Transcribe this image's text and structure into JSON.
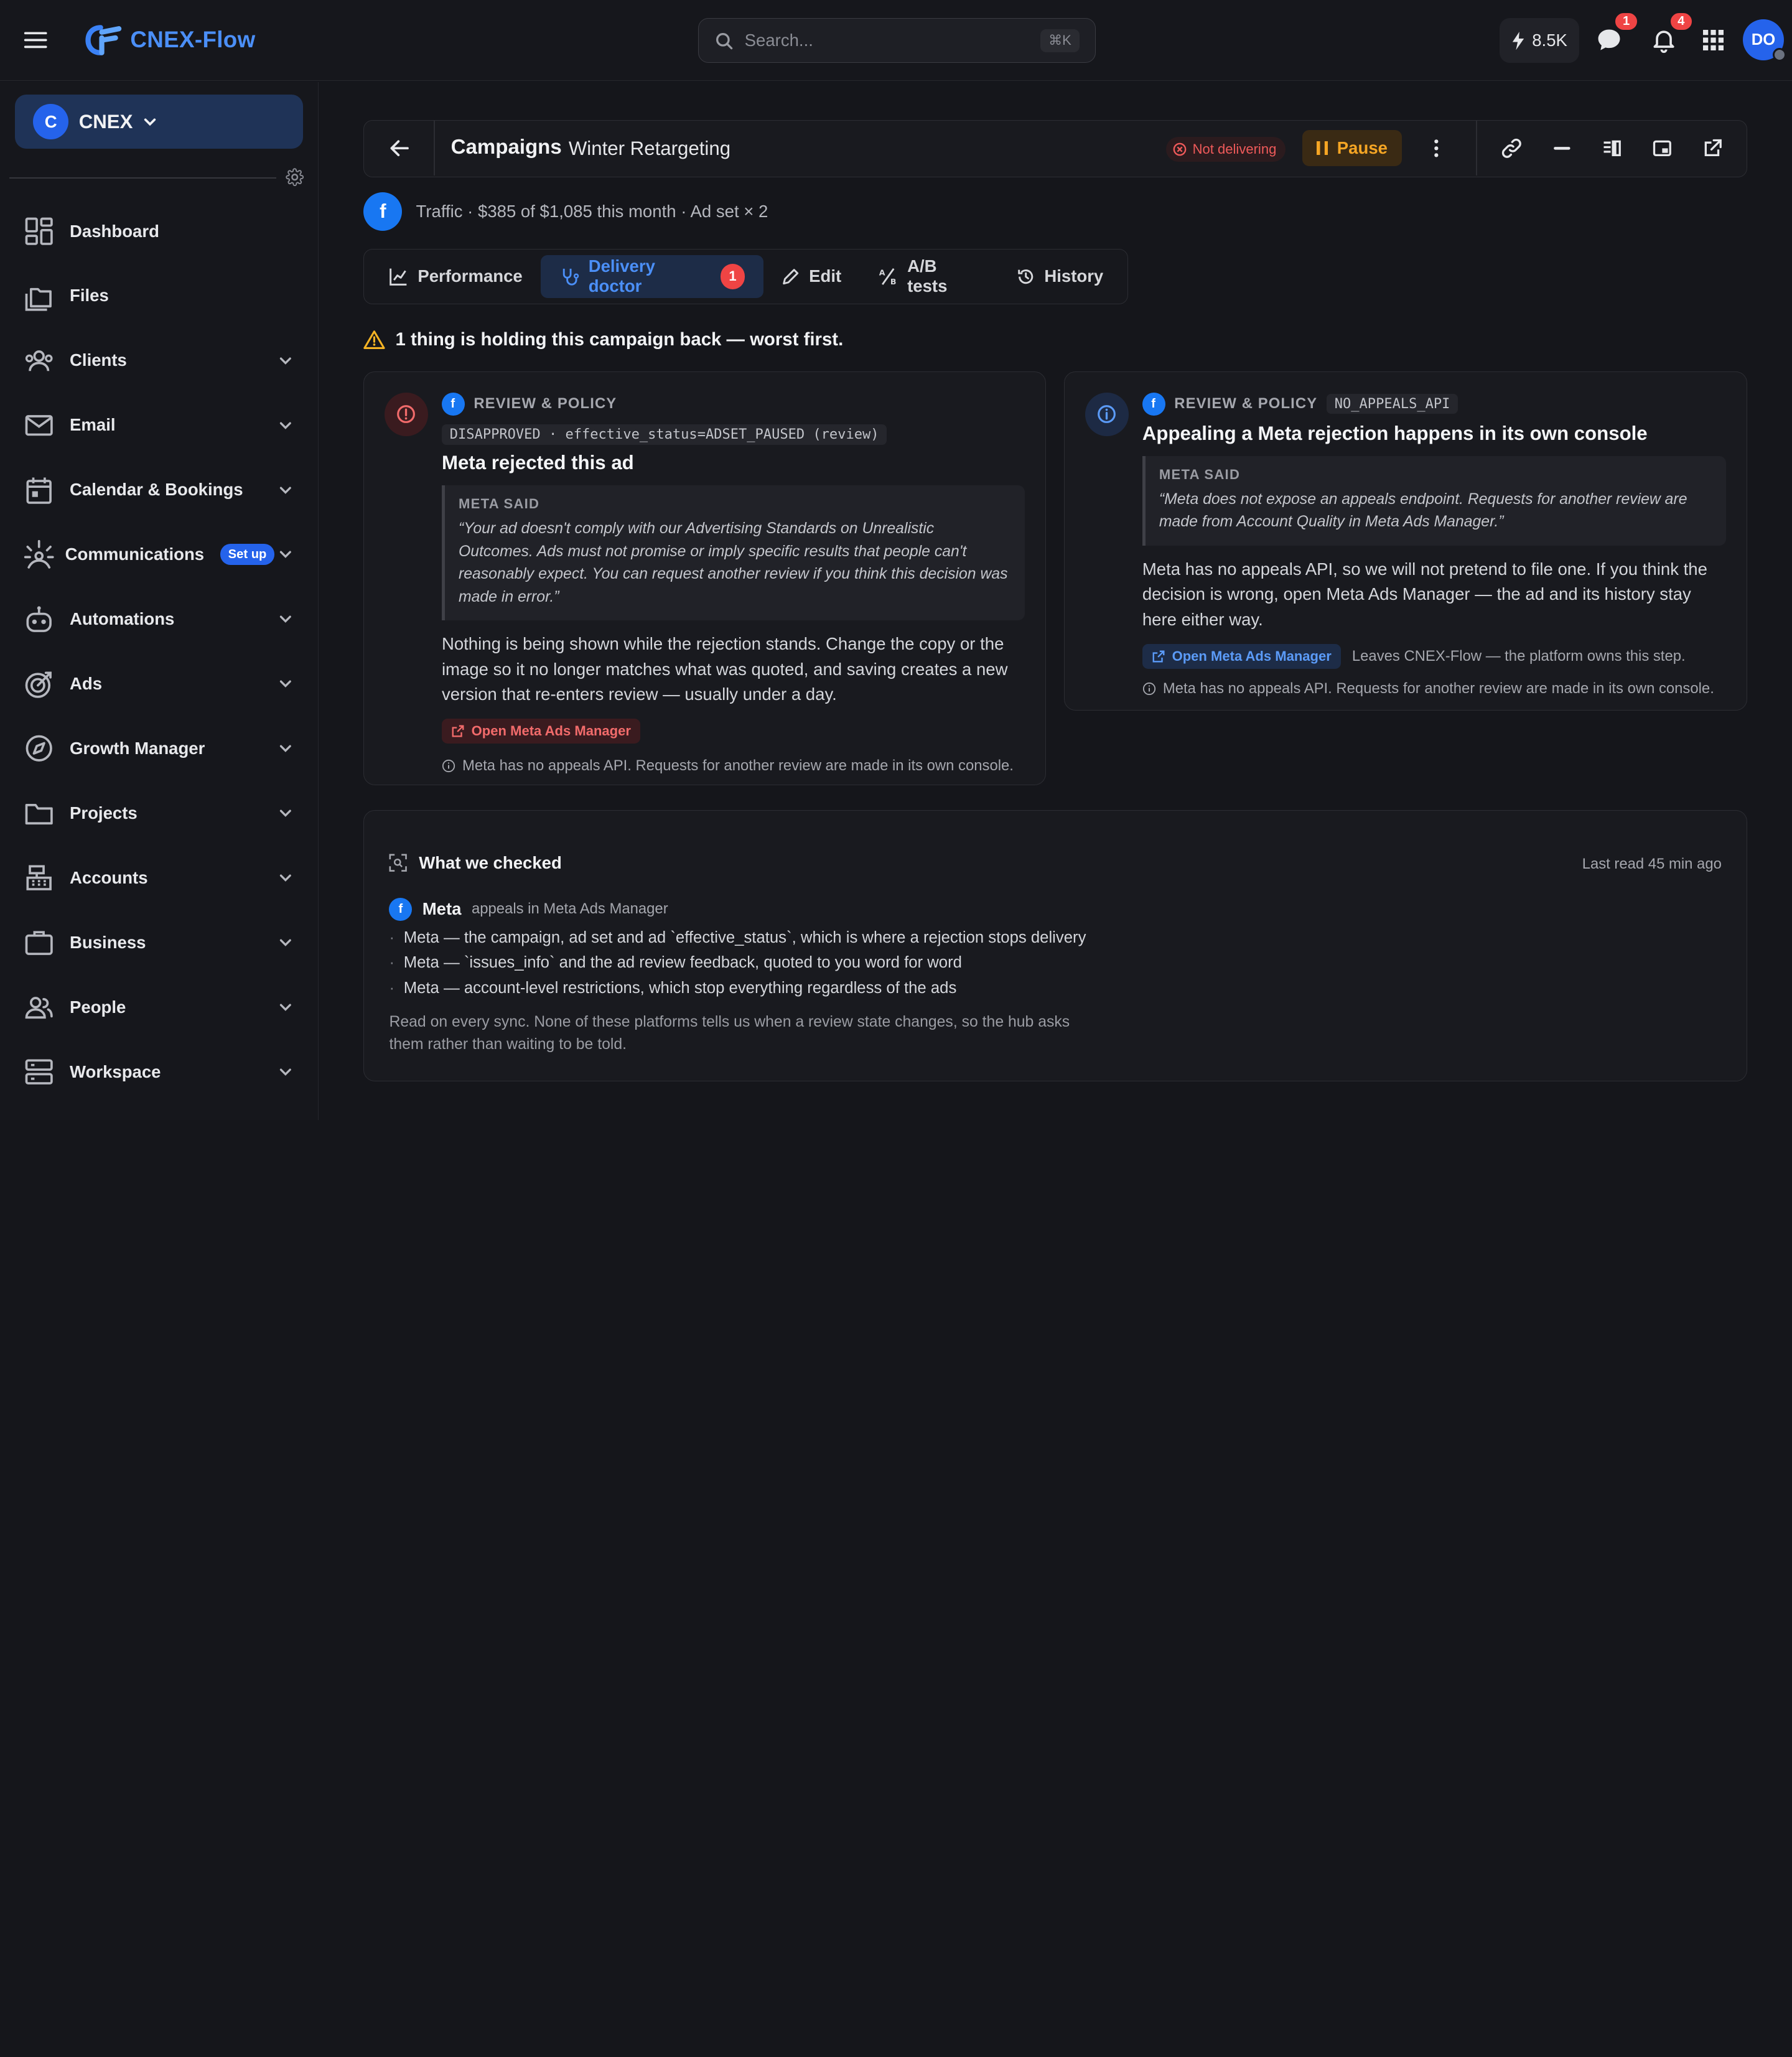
{
  "app": {
    "name": "CNEX-Flow",
    "search_placeholder": "Search...",
    "search_shortcut": "⌘K",
    "credits": "8.5K",
    "messages_count": "1",
    "notifications_count": "4",
    "user_initials": "DO"
  },
  "sidebar": {
    "org_initial": "C",
    "org_name": "CNEX",
    "items": [
      {
        "label": "Dashboard",
        "icon": "dashboard-icon"
      },
      {
        "label": "Files",
        "icon": "files-icon"
      },
      {
        "label": "Clients",
        "icon": "users-icon"
      },
      {
        "label": "Email",
        "icon": "mail-icon"
      },
      {
        "label": "Calendar & Bookings",
        "icon": "calendar-icon"
      },
      {
        "label": "Communications",
        "icon": "broadcast-icon",
        "badge": "Set up"
      },
      {
        "label": "Automations",
        "icon": "robot-icon"
      },
      {
        "label": "Ads",
        "icon": "target-icon"
      },
      {
        "label": "Growth Manager",
        "icon": "compass-icon"
      },
      {
        "label": "Projects",
        "icon": "folder-icon"
      },
      {
        "label": "Accounts",
        "icon": "register-icon"
      },
      {
        "label": "Business",
        "icon": "briefcase-icon"
      },
      {
        "label": "People",
        "icon": "people-icon"
      },
      {
        "label": "Workspace",
        "icon": "server-icon"
      }
    ]
  },
  "header": {
    "crumb_parent": "Campaigns",
    "crumb_current": "Winter Retargeting",
    "status": "Not delivering",
    "pause_label": "Pause"
  },
  "subline": {
    "platform_initial": "f",
    "text": "Traffic · $385 of $1,085 this month · Ad set × 2"
  },
  "tabs": [
    {
      "label": "Performance"
    },
    {
      "label": "Delivery doctor",
      "count": "1"
    },
    {
      "label": "Edit"
    },
    {
      "label": "A/B tests"
    },
    {
      "label": "History"
    }
  ],
  "summary": "1 thing is holding this campaign back — worst first.",
  "issues": [
    {
      "category": "REVIEW & POLICY",
      "code": "DISAPPROVED · effective_status=ADSET_PAUSED (review)",
      "title": "Meta rejected this ad",
      "quote_heading": "META SAID",
      "quote": "“Your ad doesn't comply with our Advertising Standards on Unrealistic Outcomes. Ads must not promise or imply specific results that people can't reasonably expect. You can request another review if you think this decision was made in error.”",
      "body": "Nothing is being shown while the rejection stands. Change the copy or the image so it no longer matches what was quoted, and saving creates a new version that re-enters review — usually under a day.",
      "action": "Open Meta Ads Manager",
      "note": "Meta has no appeals API. Requests for another review are made in its own console."
    },
    {
      "category": "REVIEW & POLICY",
      "code": "NO_APPEALS_API",
      "title": "Appealing a Meta rejection happens in its own console",
      "quote_heading": "META SAID",
      "quote": "“Meta does not expose an appeals endpoint. Requests for another review are made from Account Quality in Meta Ads Manager.”",
      "body": "Meta has no appeals API, so we will not pretend to file one. If you think the decision is wrong, open Meta Ads Manager — the ad and its history stay here either way.",
      "action": "Open Meta Ads Manager",
      "action_note": "Leaves CNEX-Flow — the platform owns this step.",
      "note": "Meta has no appeals API. Requests for another review are made in its own console."
    }
  ],
  "checked": {
    "title": "What we checked",
    "last_read": "Last read 45 min ago",
    "source_name": "Meta",
    "source_sub": "appeals in Meta Ads Manager",
    "items": [
      "Meta — the campaign, ad set and ad `effective_status`, which is where a rejection stops delivery",
      "Meta — `issues_info` and the ad review feedback, quoted to you word for word",
      "Meta — account-level restrictions, which stop everything regardless of the ads"
    ],
    "footer": "Read on every sync. None of these platforms tells us when a review state changes, so the hub asks them rather than waiting to be told."
  }
}
